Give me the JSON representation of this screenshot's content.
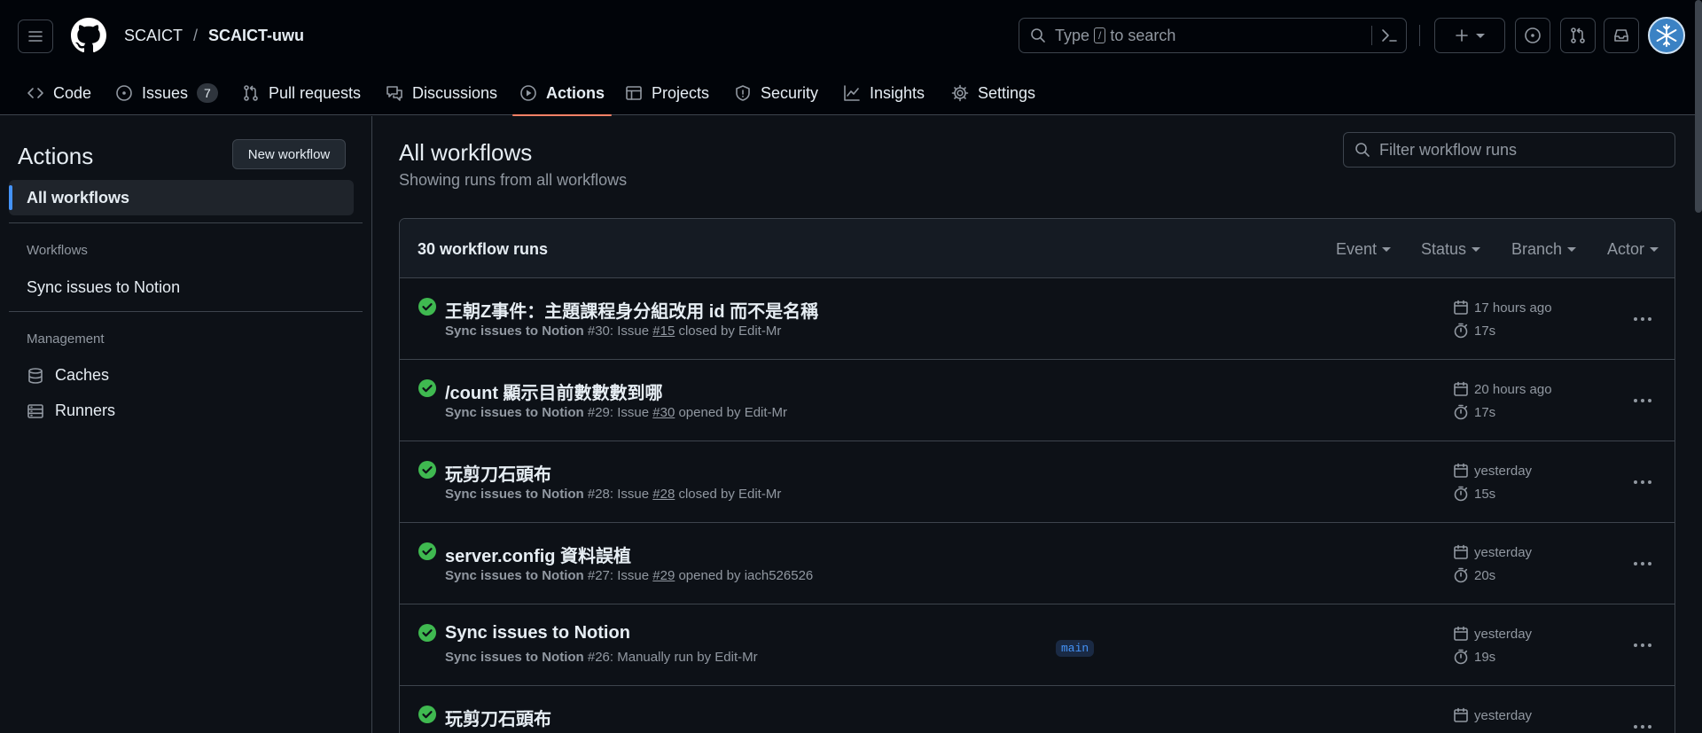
{
  "header": {
    "owner": "SCAICT",
    "separator": "/",
    "repo": "SCAICT-uwu",
    "search_placeholder_pre": "Type",
    "search_key": "/",
    "search_placeholder_post": "to search"
  },
  "tabs": [
    {
      "label": "Code",
      "icon": "code-icon"
    },
    {
      "label": "Issues",
      "icon": "issue-opened-icon",
      "count": "7"
    },
    {
      "label": "Pull requests",
      "icon": "git-pull-request-icon"
    },
    {
      "label": "Discussions",
      "icon": "comment-discussion-icon"
    },
    {
      "label": "Actions",
      "icon": "play-icon",
      "active": true
    },
    {
      "label": "Projects",
      "icon": "table-icon"
    },
    {
      "label": "Security",
      "icon": "shield-icon"
    },
    {
      "label": "Insights",
      "icon": "graph-icon"
    },
    {
      "label": "Settings",
      "icon": "gear-icon"
    }
  ],
  "sidebar": {
    "title": "Actions",
    "new_workflow": "New workflow",
    "all_workflows": "All workflows",
    "workflows_heading": "Workflows",
    "workflows": [
      "Sync issues to Notion"
    ],
    "management_heading": "Management",
    "management": [
      {
        "label": "Caches",
        "icon": "database-icon"
      },
      {
        "label": "Runners",
        "icon": "server-icon"
      }
    ]
  },
  "main": {
    "title": "All workflows",
    "subtitle": "Showing runs from all workflows",
    "filter_placeholder": "Filter workflow runs",
    "runs_count": "30 workflow runs",
    "filters": [
      "Event",
      "Status",
      "Branch",
      "Actor"
    ]
  },
  "runs": [
    {
      "title": "王朝Z事件：主題課程身分組改用 id 而不是名稱",
      "workflow": "Sync issues to Notion",
      "number": "#30",
      "pre": ": Issue ",
      "ref": "#15",
      "post": " closed by Edit-Mr",
      "time": "17 hours ago",
      "duration": "17s",
      "branch": ""
    },
    {
      "title": "/count 顯示目前數數數到哪",
      "workflow": "Sync issues to Notion",
      "number": "#29",
      "pre": ": Issue ",
      "ref": "#30",
      "post": " opened by Edit-Mr",
      "time": "20 hours ago",
      "duration": "17s",
      "branch": ""
    },
    {
      "title": "玩剪刀石頭布",
      "workflow": "Sync issues to Notion",
      "number": "#28",
      "pre": ": Issue ",
      "ref": "#28",
      "post": " closed by Edit-Mr",
      "time": "yesterday",
      "duration": "15s",
      "branch": ""
    },
    {
      "title": "server.config 資料誤植",
      "workflow": "Sync issues to Notion",
      "number": "#27",
      "pre": ": Issue ",
      "ref": "#29",
      "post": " opened by iach526526",
      "time": "yesterday",
      "duration": "20s",
      "branch": ""
    },
    {
      "title": "Sync issues to Notion",
      "workflow": "Sync issues to Notion",
      "number": "#26",
      "pre": ": Manually run by Edit-Mr",
      "ref": "",
      "post": "",
      "time": "yesterday",
      "duration": "19s",
      "branch": "main"
    },
    {
      "title": "玩剪刀石頭布",
      "workflow": "",
      "number": "",
      "pre": "",
      "ref": "",
      "post": "",
      "time": "yesterday",
      "duration": "",
      "branch": ""
    }
  ],
  "colors": {
    "success": "#3fb950",
    "accent": "#f78166",
    "link": "#4493f8"
  }
}
